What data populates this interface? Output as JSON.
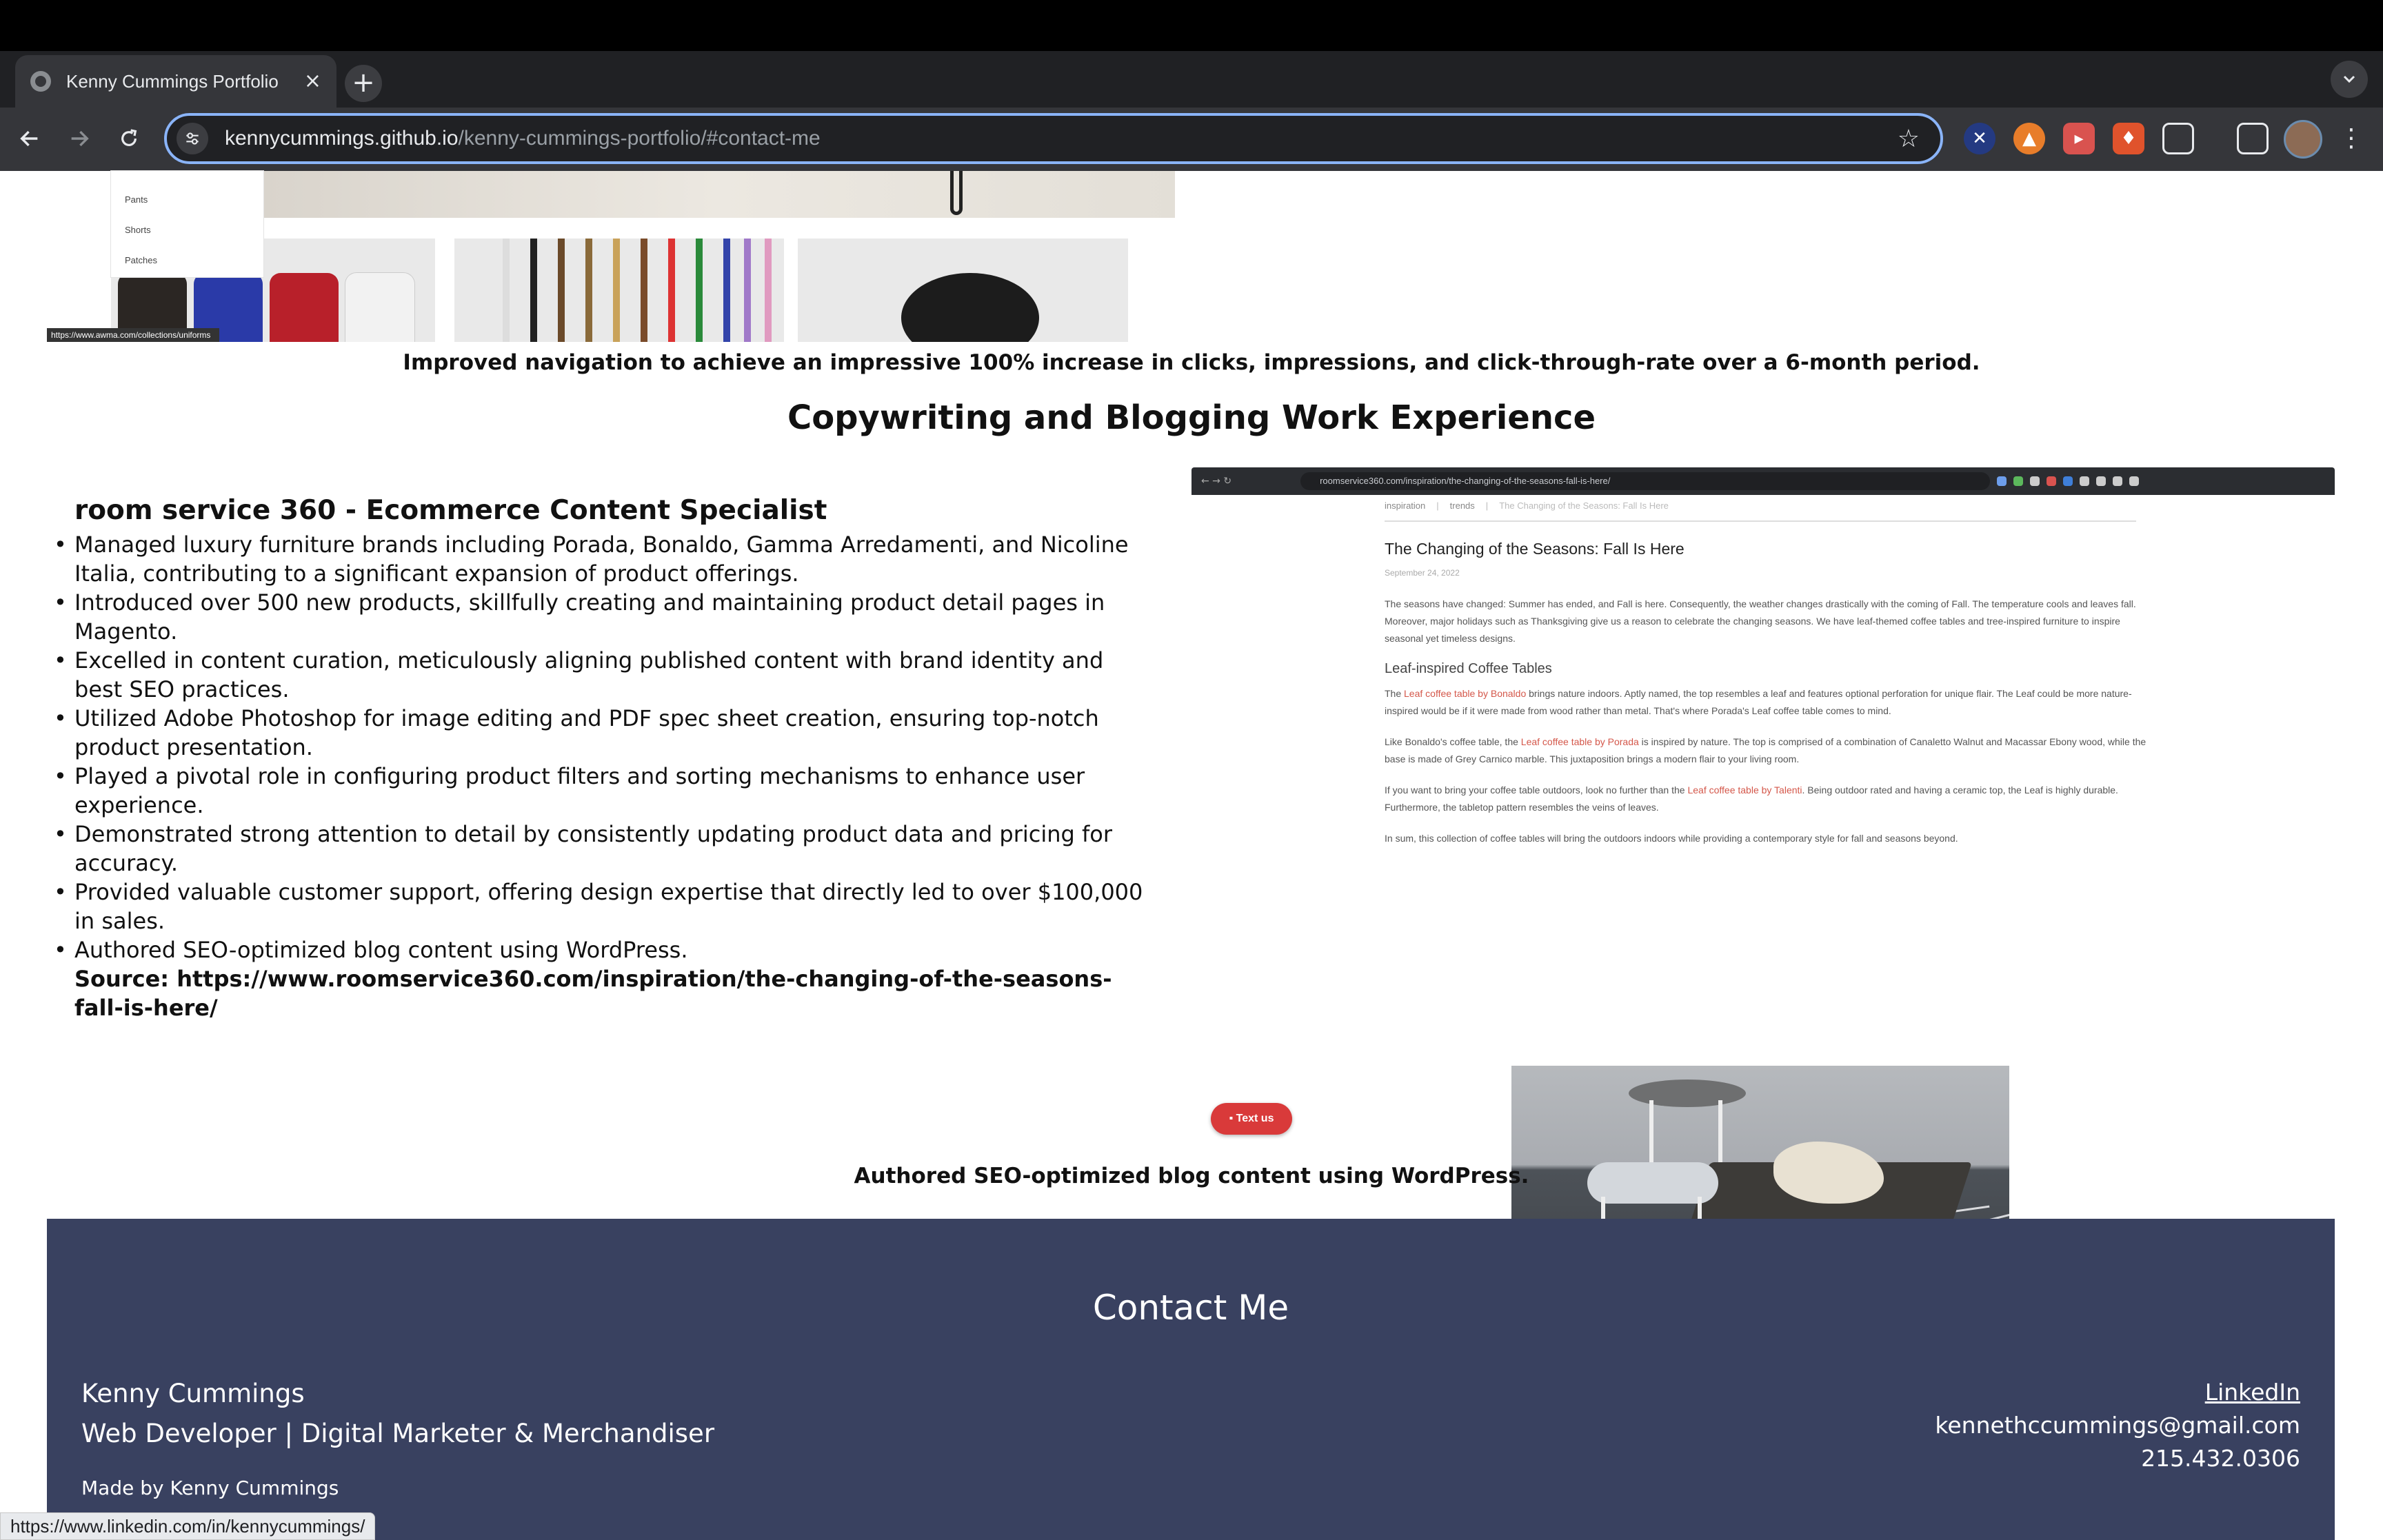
{
  "browser": {
    "tab_title": "Kenny Cummings Portfolio",
    "tab_close": "×",
    "new_tab": "+",
    "tab_menu": "⌄",
    "url_host": "kennycummings.github.io",
    "url_path": "/kenny-cummings-portfolio/#contact-me",
    "status_url": "https://www.linkedin.com/in/kennycummings/"
  },
  "icons": {
    "back": "back-arrow-icon",
    "forward": "forward-arrow-icon",
    "reload": "reload-icon",
    "site_info": "tune-icon",
    "bookmark": "star-icon",
    "extensions": "puzzle-icon",
    "sidebar": "side-panel-icon",
    "menu": "kebab-menu-icon"
  },
  "colors": {
    "footer_bg": "#394160",
    "accent": "#8ab4f8",
    "text_us": "#d93a3a",
    "blog_link": "#d4574a"
  },
  "page": {
    "navigation_caption": "Improved navigation to achieve an impressive 100% increase in clicks, impressions, and click-through-rate over a 6-month period.",
    "section_title": "Copywriting and Blogging Work Experience",
    "job": {
      "title": "room service 360 - Ecommerce Content Specialist",
      "bullets": [
        "Managed luxury furniture brands including Porada, Bonaldo, Gamma Arredamenti, and Nicoline Italia, contributing to a significant expansion of product offerings.",
        "Introduced over 500 new products, skillfully creating and maintaining product detail pages in Magento.",
        "Excelled in content curation, meticulously aligning published content with brand identity and best SEO practices.",
        "Utilized Adobe Photoshop for image editing and PDF spec sheet creation, ensuring top-notch product presentation.",
        "Played a pivotal role in configuring product filters and sorting mechanisms to enhance user experience.",
        "Demonstrated strong attention to detail by consistently updating product data and pricing for accuracy.",
        "Provided valuable customer support, offering design expertise that directly led to over $100,000 in sales.",
        "Authored SEO-optimized blog content using WordPress."
      ],
      "source": "Source: https://www.roomservice360.com/inspiration/the-changing-of-the-seasons-fall-is-here/"
    },
    "blog_caption": "Authored SEO-optimized blog content using WordPress.",
    "text_us": "Text us"
  },
  "shot1": {
    "menu_items": [
      "Pants",
      "Shorts",
      "Patches"
    ],
    "status_link": "https://www.awma.com/collections/uniforms"
  },
  "blog": {
    "url": "roomservice360.com/inspiration/the-changing-of-the-seasons-fall-is-here/",
    "crumb_1": "inspiration",
    "crumb_2": "trends",
    "crumb_3": "The Changing of the Seasons: Fall Is Here",
    "title": "The Changing of the Seasons: Fall Is Here",
    "date": "September 24, 2022",
    "p1": "The seasons have changed: Summer has ended, and Fall is here. Consequently, the weather changes drastically with the coming of Fall. The temperature cools and leaves fall. Moreover, major holidays such as Thanksgiving give us a reason to celebrate the changing seasons. We have leaf-themed coffee tables and tree-inspired furniture to inspire seasonal yet timeless designs.",
    "h2": "Leaf-inspired Coffee Tables",
    "p2_a": "The ",
    "p2_link": "Leaf coffee table by Bonaldo",
    "p2_b": " brings nature indoors. Aptly named, the top resembles a leaf and features optional perforation for unique flair. The Leaf could be more nature-inspired would be if it were made from wood rather than metal. That's where Porada's Leaf coffee table comes to mind.",
    "p3_a": "Like Bonaldo's coffee table, the ",
    "p3_link": "Leaf coffee table by Porada",
    "p3_b": " is inspired by nature. The top is comprised of a combination of Canaletto Walnut and Macassar Ebony wood, while the base is made of Grey Carnico marble. This juxtaposition brings a modern flair to your living room.",
    "p4_a": "If you want to bring your coffee table outdoors, look no further than the ",
    "p4_link": "Leaf coffee table by Talenti",
    "p4_b": ". Being outdoor rated and having a ceramic top, the Leaf is highly durable. Furthermore, the tabletop pattern resembles the veins of leaves.",
    "p5": "In sum, this collection of coffee tables will bring the outdoors indoors while providing a contemporary style for fall and seasons beyond."
  },
  "footer": {
    "title": "Contact Me",
    "name": "Kenny Cummings",
    "role": "Web Developer | Digital Marketer & Merchandiser",
    "made_by": "Made by Kenny Cummings",
    "linkedin": "LinkedIn",
    "email": "kennethccummings@gmail.com",
    "phone": "215.432.0306"
  }
}
